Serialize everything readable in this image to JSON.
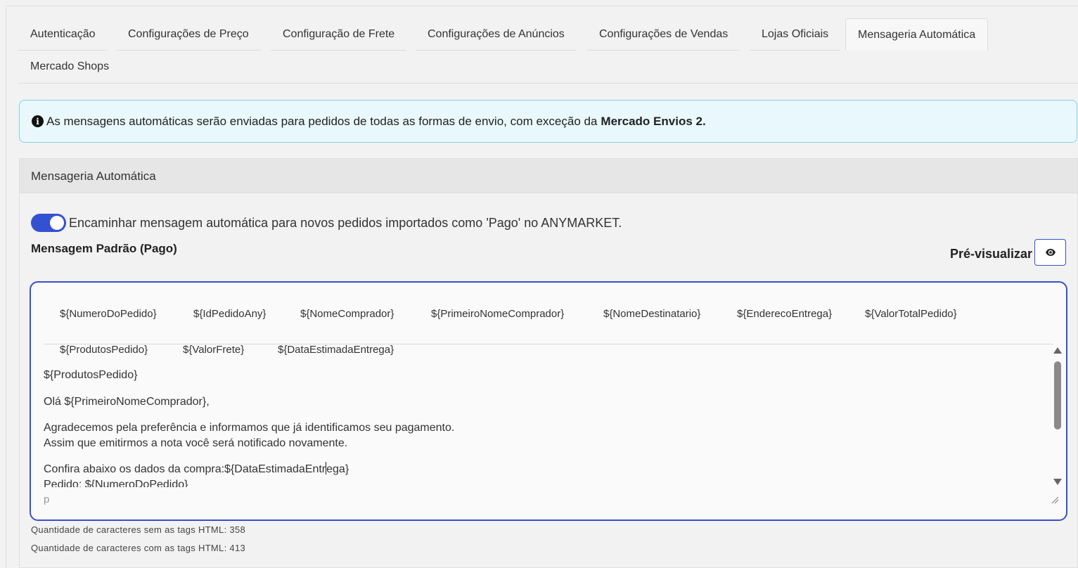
{
  "tabs": [
    {
      "label": "Autenticação",
      "active": false
    },
    {
      "label": "Configurações de Preço",
      "active": false
    },
    {
      "label": "Configuração de Frete",
      "active": false
    },
    {
      "label": "Configurações de Anúncios",
      "active": false
    },
    {
      "label": "Configurações de Vendas",
      "active": false
    },
    {
      "label": "Lojas Oficiais",
      "active": false
    },
    {
      "label": "Mensageria Automática",
      "active": true
    },
    {
      "label": "Mercado Shops",
      "active": false
    }
  ],
  "alert": {
    "icon": "info-circle-icon",
    "text": "As mensagens automáticas serão enviadas para pedidos de todas as formas de envio, com exceção da",
    "bold": "Mercado Envios 2."
  },
  "panel": {
    "title": "Mensageria Automática",
    "toggle": {
      "label": "Encaminhar mensagem automática para novos pedidos importados como 'Pago' no ANYMARKET.",
      "checked": true,
      "color": "#3451d1"
    },
    "message_label": "Mensagem Padrão (Pago)",
    "preview_label": "Pré-visualizar",
    "preview_icon": "eye-icon"
  },
  "editor": {
    "tags": [
      "${NumeroDoPedido}",
      "${IdPedidoAny}",
      "${NomeComprador}",
      "${PrimeiroNomeComprador}",
      "${NomeDestinatario}",
      "${EnderecoEntrega}",
      "${ValorTotalPedido}",
      "${ProdutosPedido}",
      "${ValorFrete}",
      "${DataEstimadaEntrega}"
    ],
    "lines": {
      "l1": "${ProdutosPedido}",
      "l2": "Olá ${PrimeiroNomeComprador},",
      "l3": "Agradecemos pela preferência e informamos que já identificamos seu pagamento.",
      "l4": "Assim que emitirmos a nota você será notificado novamente.",
      "l5a": "Confira abaixo os dados da compra:${DataEstimadaEntr",
      "l5b": "ega}",
      "l6": "Pedido: ${NumeroDoPedido}"
    },
    "status_path": "p",
    "border_color": "#3a4fc9"
  },
  "counts": {
    "without_html": "Quantidade de caracteres sem as tags HTML: 358",
    "with_html": "Quantidade de caracteres com as tags HTML: 413"
  }
}
